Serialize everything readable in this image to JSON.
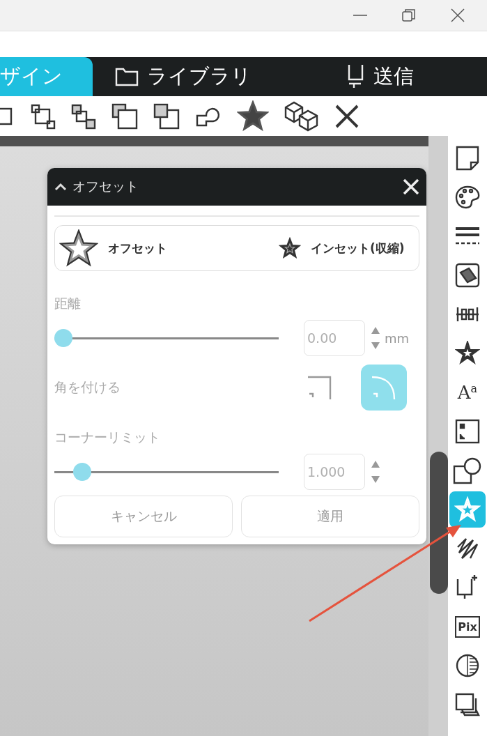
{
  "tabs": [
    {
      "label": "ザイン",
      "kind": "none",
      "selected": true
    },
    {
      "label": "ライブラリ",
      "kind": "folder",
      "selected": false
    },
    {
      "label": "送信",
      "kind": "send",
      "selected": false
    }
  ],
  "toolbar": [
    {
      "kind": "nodes"
    },
    {
      "kind": "group"
    },
    {
      "kind": "ungroup"
    },
    {
      "kind": "front"
    },
    {
      "kind": "back"
    },
    {
      "kind": "weld"
    },
    {
      "kind": "star"
    },
    {
      "kind": "cubes"
    },
    {
      "kind": "cross"
    }
  ],
  "dialog": {
    "title": "オフセット",
    "expanded": true,
    "modes": [
      {
        "kind": "outset",
        "label": "オフセット"
      },
      {
        "kind": "inset",
        "label": "インセット(収縮)"
      }
    ],
    "distance": {
      "label": "距離",
      "level": 0,
      "value": "0.00",
      "unit": "mm"
    },
    "corner": {
      "label": "角を付ける",
      "options": [
        {
          "kind": "sharp",
          "selected": false
        },
        {
          "kind": "round",
          "selected": true
        }
      ]
    },
    "corner_limit": {
      "label": "コーナーリミット",
      "level": 0.09,
      "value": "1.000"
    },
    "buttons": [
      "キャンセル",
      "適用"
    ]
  },
  "sidebar": {
    "items": [
      {
        "kind": "note",
        "selected": false
      },
      {
        "kind": "palette",
        "selected": false
      },
      {
        "kind": "lines",
        "selected": false
      },
      {
        "kind": "fill",
        "selected": false
      },
      {
        "kind": "align",
        "selected": false
      },
      {
        "kind": "burst",
        "selected": false
      },
      {
        "kind": "text",
        "glyph": "A",
        "sub": "a",
        "selected": false
      },
      {
        "kind": "frame",
        "selected": false
      },
      {
        "kind": "shapes",
        "selected": false
      },
      {
        "kind": "star",
        "selected": true
      },
      {
        "kind": "sketch",
        "selected": false
      },
      {
        "kind": "pen",
        "selected": false
      },
      {
        "kind": "pix",
        "glyph": "Pix",
        "selected": false
      },
      {
        "kind": "contrast",
        "selected": false
      },
      {
        "kind": "layer",
        "selected": false
      }
    ]
  }
}
